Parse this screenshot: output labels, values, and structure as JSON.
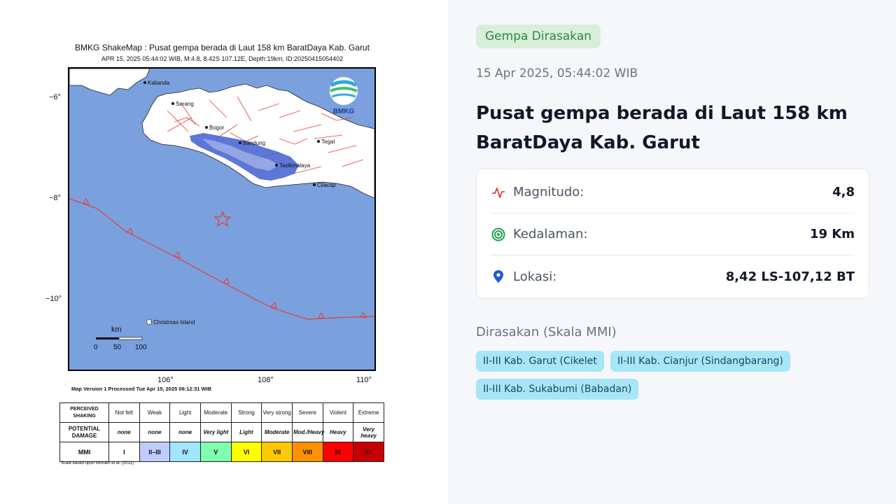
{
  "map": {
    "title": "BMKG ShakeMap : Pusat gempa berada di Laut 158 km BaratDaya Kab. Garut",
    "subtitle": "APR 15, 2025 05:44:02 WIB, M:4.8, 8.42S 107.12E, Depth:19km, ID:20250415054402",
    "logo_text": "BMKG",
    "places": [
      "Kalianda",
      "Serang",
      "Bogor",
      "Bandung",
      "Tasikmalaya",
      "Tegal",
      "Cilacap",
      "Christmas Island"
    ],
    "lat_labels": [
      "−6°",
      "−8°",
      "−10°"
    ],
    "lon_labels": [
      "106°",
      "108°",
      "110°"
    ],
    "scalebar": {
      "unit": "km",
      "ticks": [
        "0",
        "50",
        "100"
      ]
    },
    "version_text": "Map Version 1 Processed Tue Apr 15, 2025 06:12:31 WIB",
    "colors": {
      "sea": "#7aa0dd",
      "land": "#ffffff",
      "fault": "#e0403a",
      "epicenter": "#e0403a",
      "shaking": "#3f5fd0"
    }
  },
  "mmi_table": {
    "row_headers": [
      "PERCEIVED SHAKING",
      "POTENTIAL DAMAGE",
      "MMI"
    ],
    "shaking": [
      "Not felt",
      "Weak",
      "Light",
      "Moderate",
      "Strong",
      "Very strong",
      "Severe",
      "Violent",
      "Extreme"
    ],
    "damage": [
      "none",
      "none",
      "none",
      "Very light",
      "Light",
      "Moderate",
      "Mod./Heavy",
      "Heavy",
      "Very heavy"
    ],
    "mmi": [
      "I",
      "II–III",
      "IV",
      "V",
      "VI",
      "VII",
      "VIII",
      "IX",
      "X+"
    ],
    "mmi_colors": [
      "#ffffff",
      "#bfccff",
      "#a0e6ff",
      "#80ffb0",
      "#ffff00",
      "#ffc800",
      "#ff9100",
      "#ff0000",
      "#c80000"
    ],
    "note": "Scale based upon Worden et al. (2011)"
  },
  "panel": {
    "badge": "Gempa Dirasakan",
    "datetime": "15 Apr 2025, 05:44:02 WIB",
    "title": "Pusat gempa berada di Laut 158 km BaratDaya Kab. Garut",
    "rows": [
      {
        "icon": "activity-icon",
        "label": "Magnitudo:",
        "value": "4,8"
      },
      {
        "icon": "target-icon",
        "label": "Kedalaman:",
        "value": "19 Km"
      },
      {
        "icon": "location-pin-icon",
        "label": "Lokasi:",
        "value": "8,42 LS-107,12 BT"
      }
    ],
    "felt_heading": "Dirasakan (Skala MMI)",
    "felt_chips": [
      "II-III Kab. Garut (Cikelet",
      "II-III Kab. Cianjur (Sindangbarang)",
      "II-III Kab. Sukabumi (Babadan)"
    ],
    "colors": {
      "badge_bg": "#d8eedb",
      "badge_text": "#2d8a3b",
      "chip_bg": "#a7e6f7",
      "activity": "#e0403a",
      "target": "#1fa34a",
      "pin": "#1f57d6"
    }
  }
}
